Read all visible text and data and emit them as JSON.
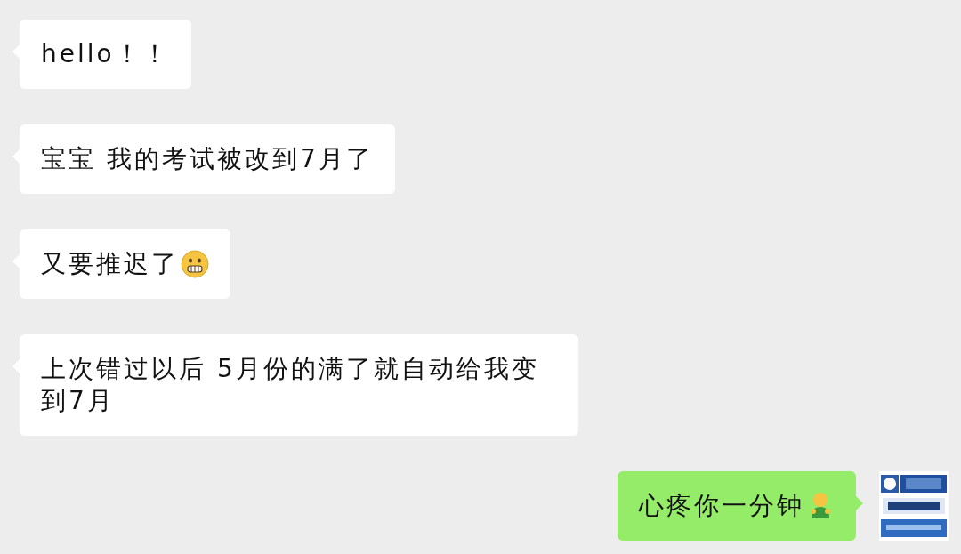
{
  "messages": [
    {
      "kind": "received",
      "text": "hello！！"
    },
    {
      "kind": "received",
      "text": "宝宝 我的考试被改到7月了"
    },
    {
      "kind": "received",
      "text": "又要推迟了",
      "emoji": true
    },
    {
      "kind": "received",
      "text": "上次错过以后 5月份的满了就自动给我变到7月"
    },
    {
      "kind": "sent",
      "text": "心疼你一分钟",
      "emoji": true
    }
  ]
}
